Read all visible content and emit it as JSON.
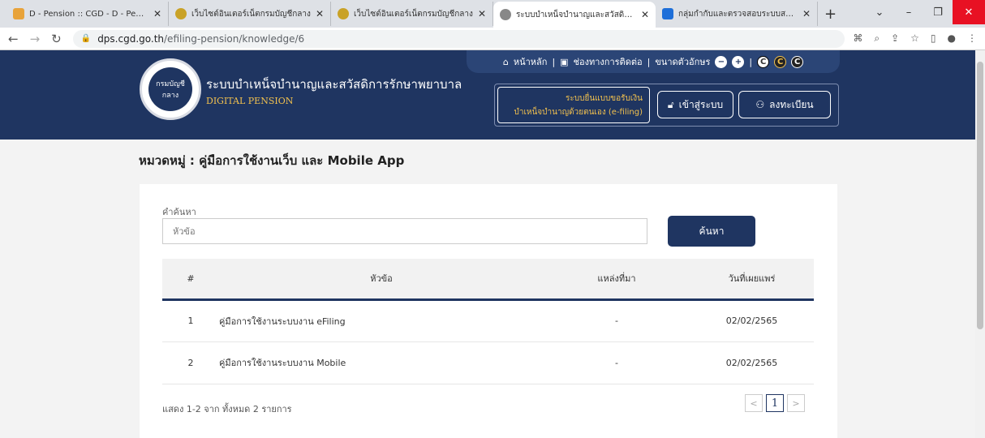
{
  "browser": {
    "tabs": [
      {
        "title": "D - Pension :: CGD - D - Pension",
        "favicon_color": "#e8a33a"
      },
      {
        "title": "เว็บไซต์อินเตอร์เน็ตกรมบัญชีกลาง",
        "favicon_color": "#c9a227"
      },
      {
        "title": "เว็บไซต์อินเตอร์เน็ตกรมบัญชีกลาง",
        "favicon_color": "#c9a227"
      },
      {
        "title": "ระบบบำเหน็จบำนาญและสวัสดิการรักษ",
        "favicon_color": "#888888"
      },
      {
        "title": "กลุ่มกำกับและตรวจสอบระบบสวัสดิการ",
        "favicon_color": "#1e6fd9"
      }
    ],
    "new_tab": "+",
    "url_host": "dps.cgd.go.th",
    "url_path": "/efiling-pension/knowledge/6"
  },
  "header": {
    "logo_text": "กรมบัญชีกลาง",
    "title": "ระบบบำเหน็จบำนาญและสวัสดิการรักษาพยาบาล",
    "subtitle": "DIGITAL PENSION",
    "topnav": {
      "home": "หน้าหลัก",
      "contact": "ช่องทางการติดต่อ",
      "font_size": "ขนาดตัวอักษร",
      "minus": "−",
      "plus": "+",
      "c1": "C",
      "c2": "C",
      "c3": "C"
    },
    "efile_line1": "ระบบยื่นแบบขอรับเงิน",
    "efile_line2": "บำเหน็จบำนาญด้วยตนเอง (e-filing)",
    "login": "เข้าสู่ระบบ",
    "register": "ลงทะเบียน"
  },
  "page": {
    "category": "หมวดหมู่ : คู่มือการใช้งานเว็บ และ Mobile App",
    "search_label": "คำค้นหา",
    "search_placeholder": "หัวข้อ",
    "search_button": "ค้นหา",
    "columns": [
      "#",
      "หัวข้อ",
      "แหล่งที่มา",
      "วันที่เผยแพร่"
    ],
    "rows": [
      {
        "no": "1",
        "topic": "คู่มือการใช้งานระบบงาน eFiling",
        "source": "-",
        "date": "02/02/2565"
      },
      {
        "no": "2",
        "topic": "คู่มือการใช้งานระบบงาน Mobile",
        "source": "-",
        "date": "02/02/2565"
      }
    ],
    "summary": "แสดง 1-2 จาก ทั้งหมด 2 รายการ",
    "pager": {
      "prev": "<",
      "current": "1",
      "next": ">"
    }
  },
  "colors": {
    "navy": "#1f3561",
    "gold": "#f2c14e"
  }
}
